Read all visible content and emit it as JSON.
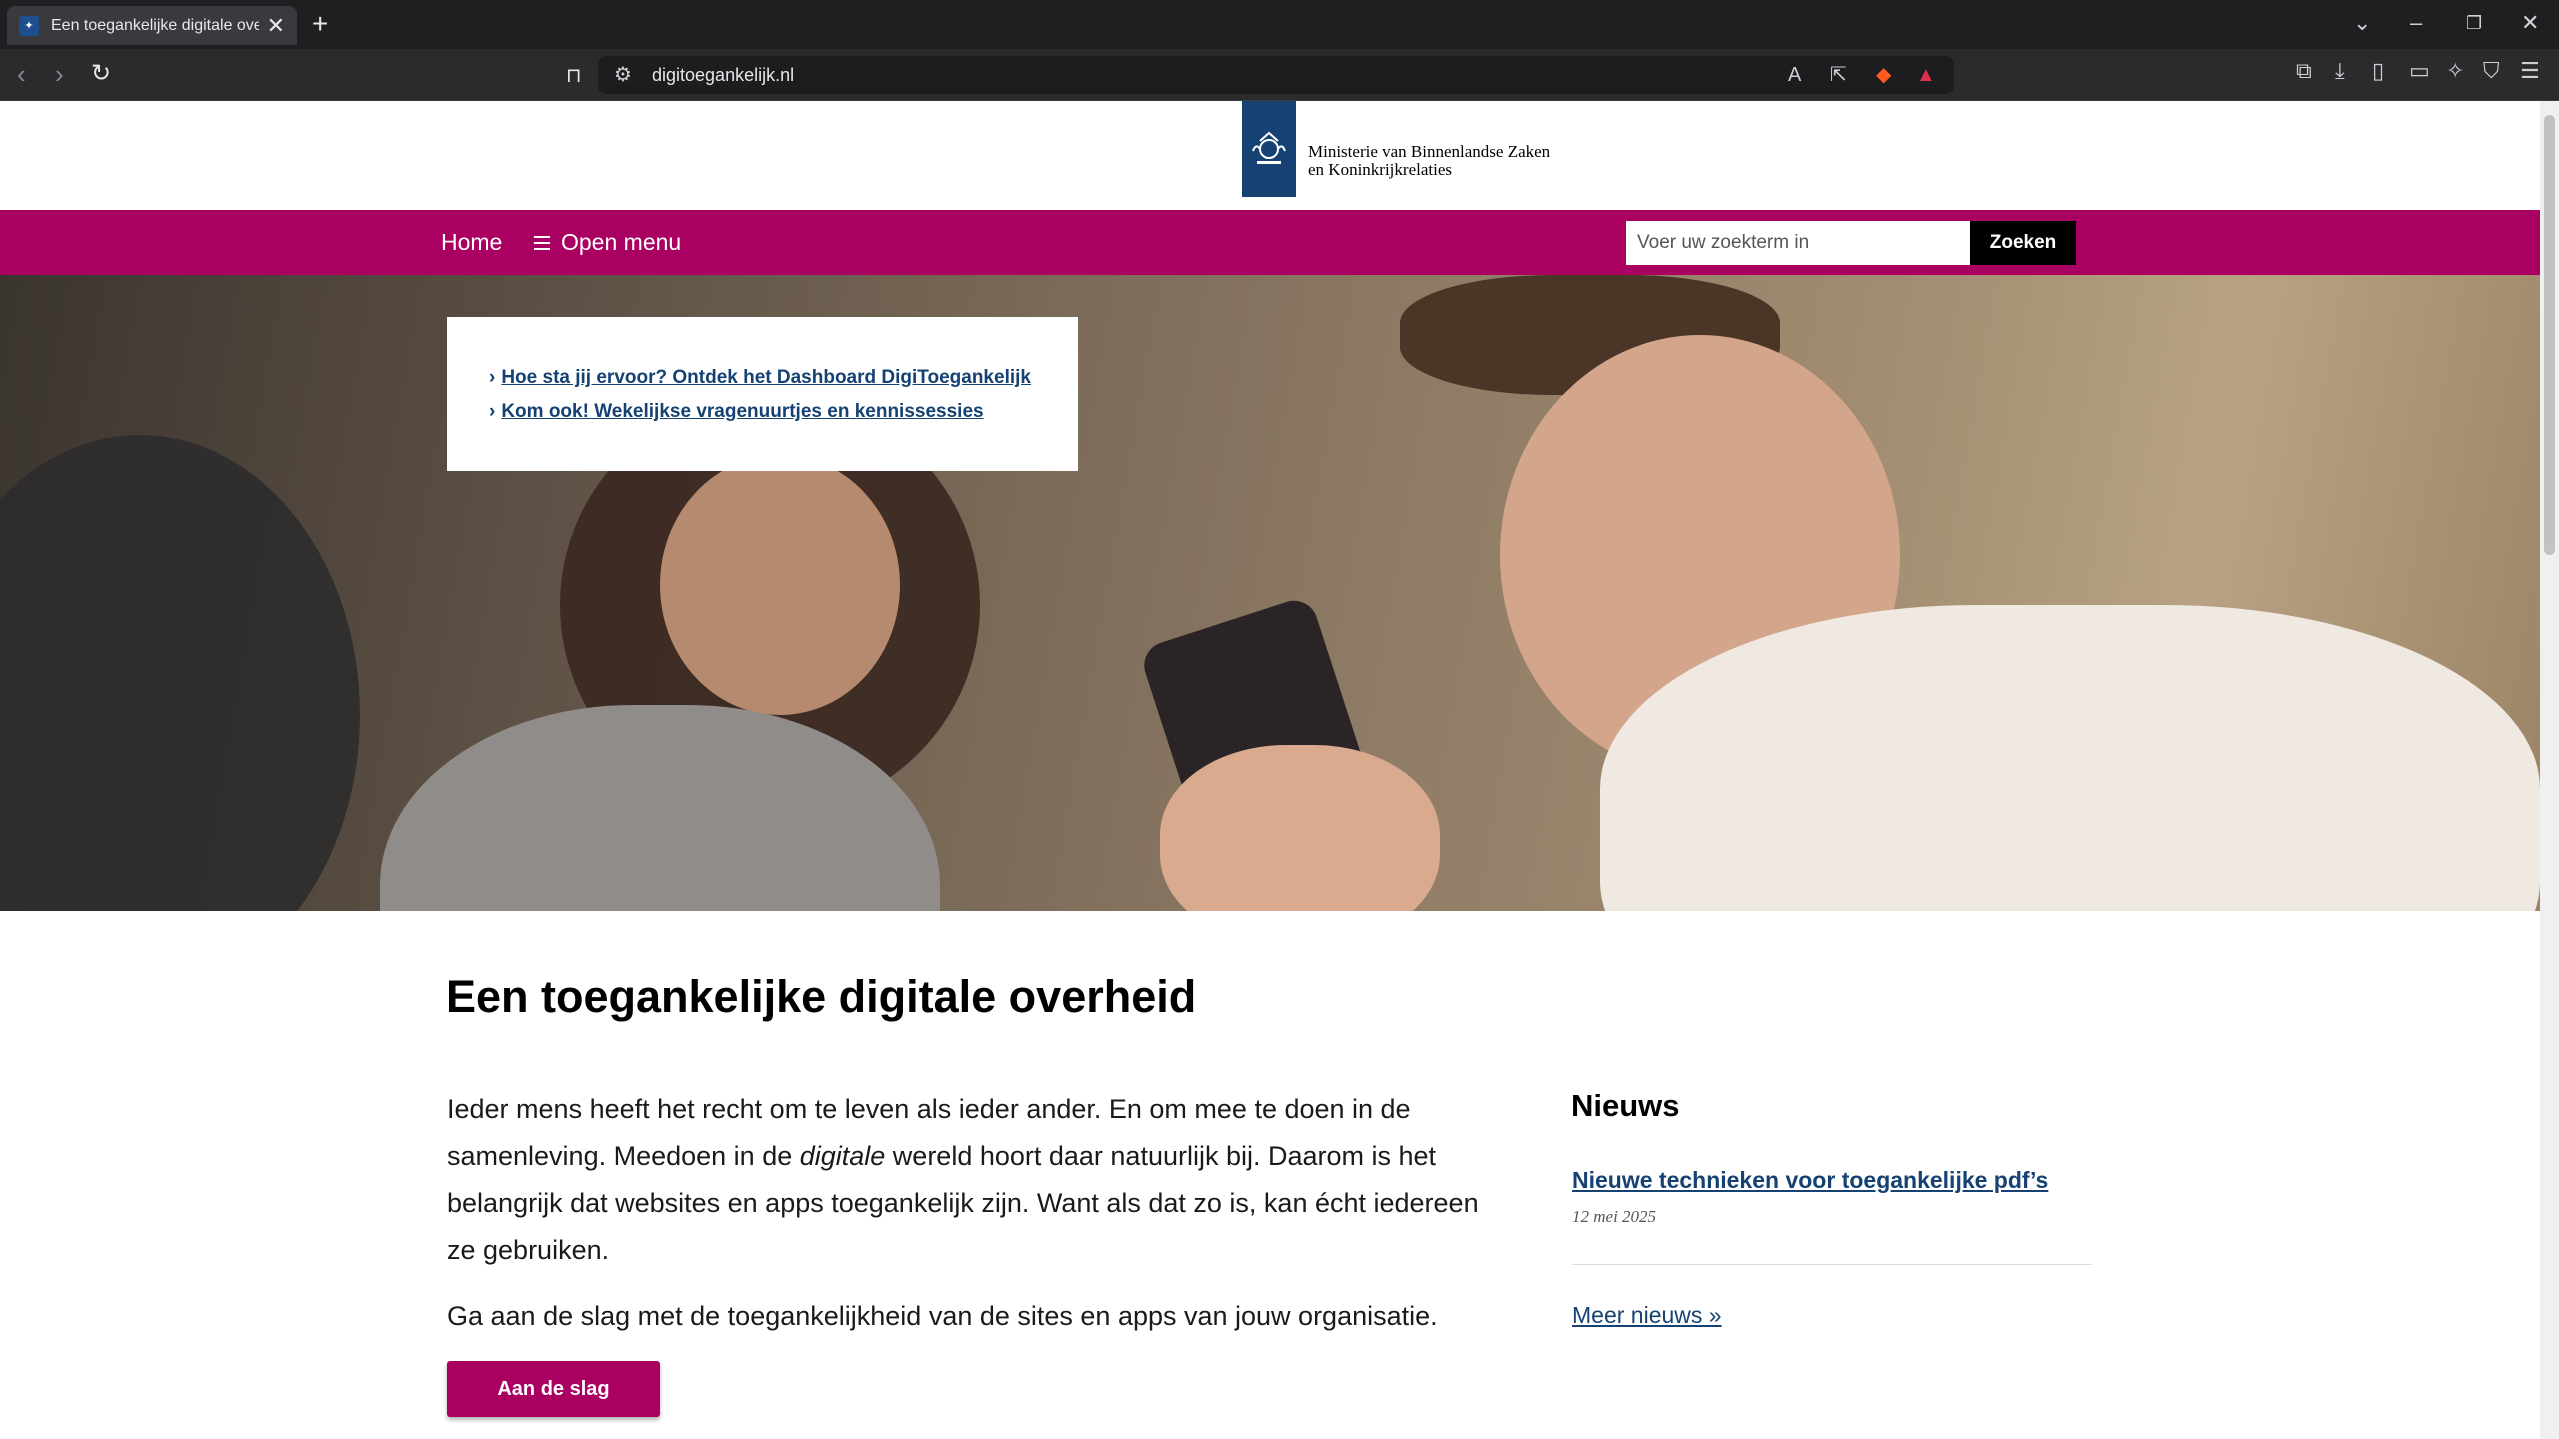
{
  "browser": {
    "tab_title": "Een toegankelijke digitale overheid",
    "new_tab": "+",
    "close": "✕",
    "url": "digitoegankelijk.nl"
  },
  "header": {
    "org_line1": "Ministerie van Binnenlandse Zaken",
    "org_line2": "en Koninkrijkrelaties"
  },
  "nav": {
    "home": "Home",
    "open_menu": "Open menu",
    "search_placeholder": "Voer uw zoekterm in",
    "search_button": "Zoeken"
  },
  "hero": {
    "links": [
      "Hoe sta jij ervoor? Ontdek het Dashboard DigiToegankelijk",
      "Kom ook! Wekelijkse vragenuurtjes en kennissessies"
    ]
  },
  "main": {
    "title": "Een toegankelijke digitale overheid",
    "intro_part1": "Ieder mens heeft het recht om te leven als ieder ander. En om mee te doen in de samenleving. Meedoen in de ",
    "intro_emph": "digitale",
    "intro_part2": " wereld hoort daar natuurlijk bij. Daarom is het belangrijk dat websites en apps toegankelijk zijn. Want als dat zo is, kan écht iedereen ze gebruiken.",
    "intro_2": "Ga aan de slag met de toegankelijkheid van de sites en apps van jouw organisatie.",
    "cta": "Aan de slag"
  },
  "news": {
    "title": "Nieuws",
    "item_title": "Nieuwe technieken voor toegankelijke pdf’s",
    "item_date": "12 mei 2025",
    "more": "Meer nieuws »"
  },
  "colors": {
    "brand": "#a90061",
    "logo": "#154273",
    "link": "#154273"
  }
}
